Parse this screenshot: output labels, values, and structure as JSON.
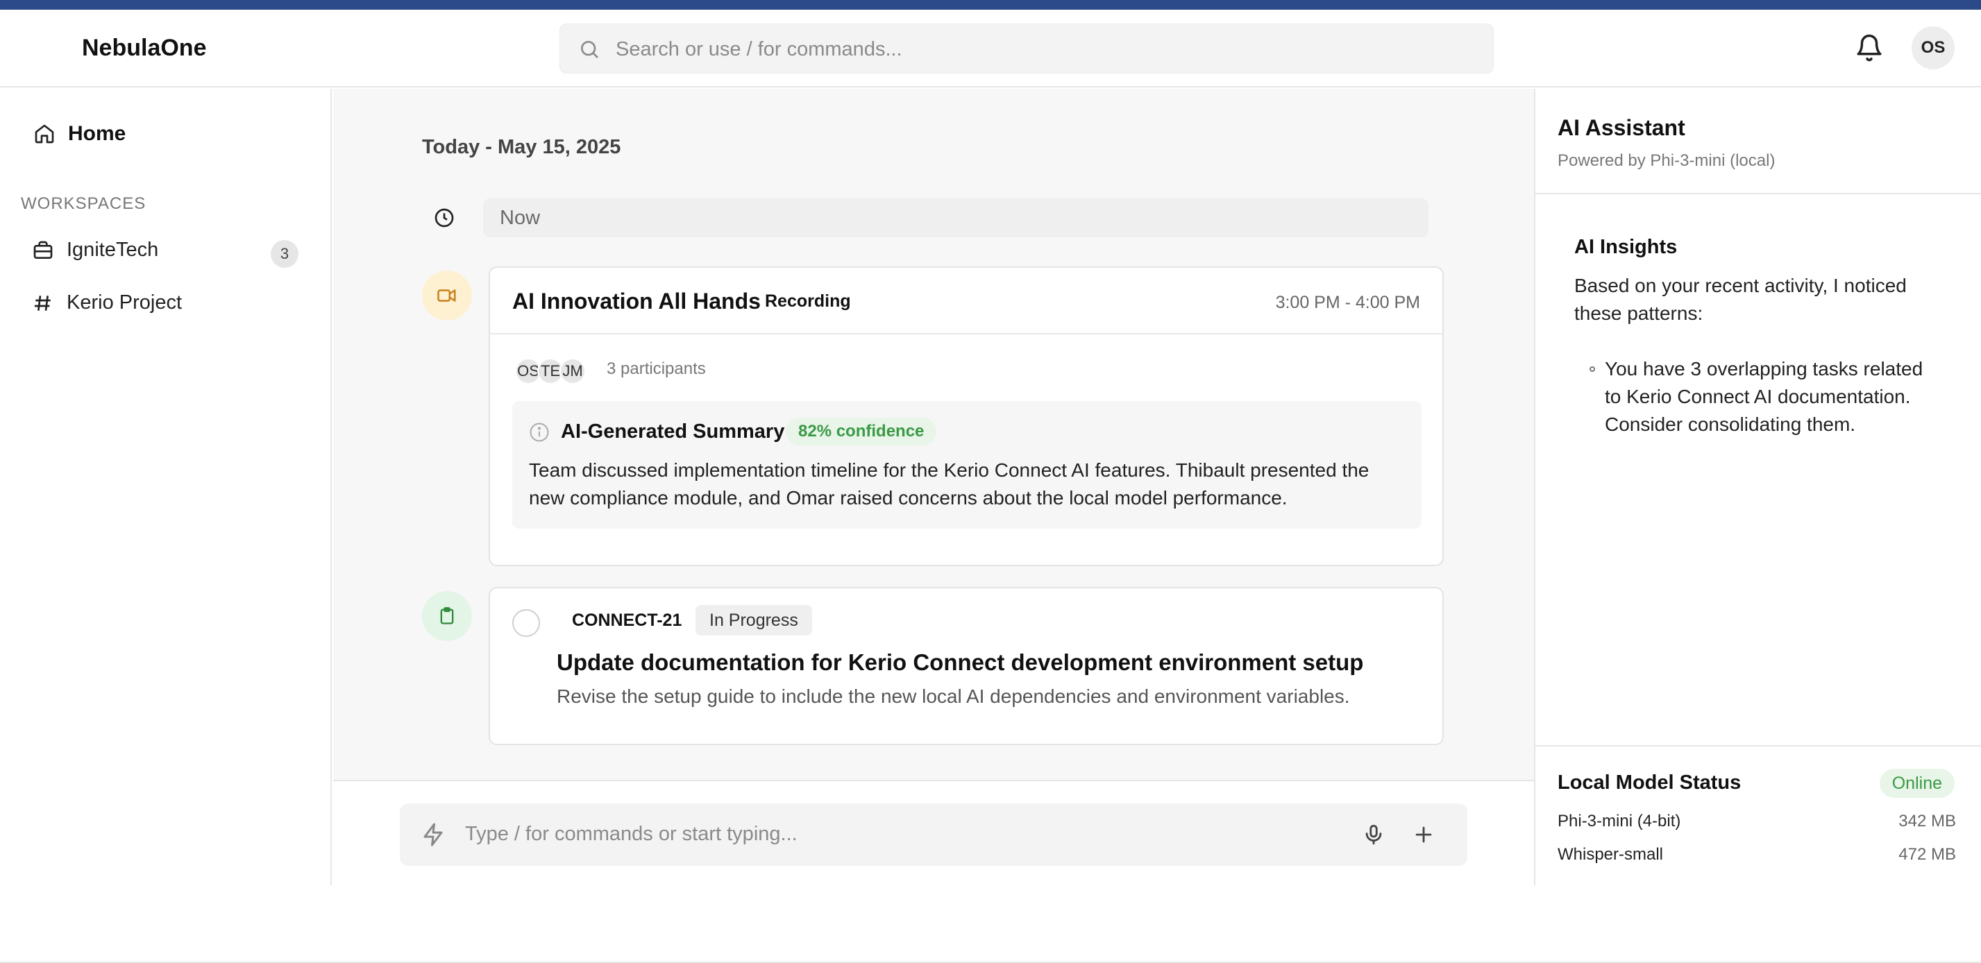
{
  "app": {
    "name": "NebulaOne"
  },
  "search": {
    "placeholder": "Search or use / for commands..."
  },
  "user": {
    "initials": "OS"
  },
  "sidebar": {
    "home_label": "Home",
    "section_label": "WORKSPACES",
    "items": [
      {
        "label": "IgniteTech",
        "badge": "3",
        "icon": "briefcase-icon"
      },
      {
        "label": "Kerio Project",
        "icon": "hash-icon"
      }
    ]
  },
  "feed": {
    "date_heading": "Today - May 15, 2025",
    "now_label": "Now",
    "meeting": {
      "title": "AI Innovation All Hands",
      "status": "Recording",
      "time": "3:00 PM - 4:00 PM",
      "participants": [
        "OS",
        "TE",
        "JM"
      ],
      "participants_label": "3 participants",
      "summary_title": "AI-Generated Summary",
      "confidence": "82% confidence",
      "summary": "Team discussed implementation timeline for the Kerio Connect AI features. Thibault presented the new compliance module, and Omar raised concerns about the local model performance."
    },
    "task": {
      "id": "CONNECT-21",
      "status": "In Progress",
      "title": "Update documentation for Kerio Connect development environment setup",
      "description": "Revise the setup guide to include the new local AI dependencies and environment variables."
    }
  },
  "composer": {
    "placeholder": "Type / for commands or start typing..."
  },
  "assistant": {
    "title": "AI Assistant",
    "subtitle": "Powered by Phi-3-mini (local)",
    "insights_title": "AI Insights",
    "insights_intro": "Based on your recent activity, I noticed these patterns:",
    "insights": [
      "You have 3 overlapping tasks related to Kerio Connect AI documentation. Consider consolidating them."
    ],
    "status_title": "Local Model Status",
    "status": "Online",
    "models": [
      {
        "name": "Phi-3-mini (4-bit)",
        "size": "342 MB"
      },
      {
        "name": "Whisper-small",
        "size": "472 MB"
      }
    ]
  },
  "colors": {
    "accent_bar": "#2c4a8a",
    "meeting_icon_bg": "#fdf1d2",
    "task_icon_bg": "#e3f5e6",
    "online_green": "#3a9a47"
  }
}
